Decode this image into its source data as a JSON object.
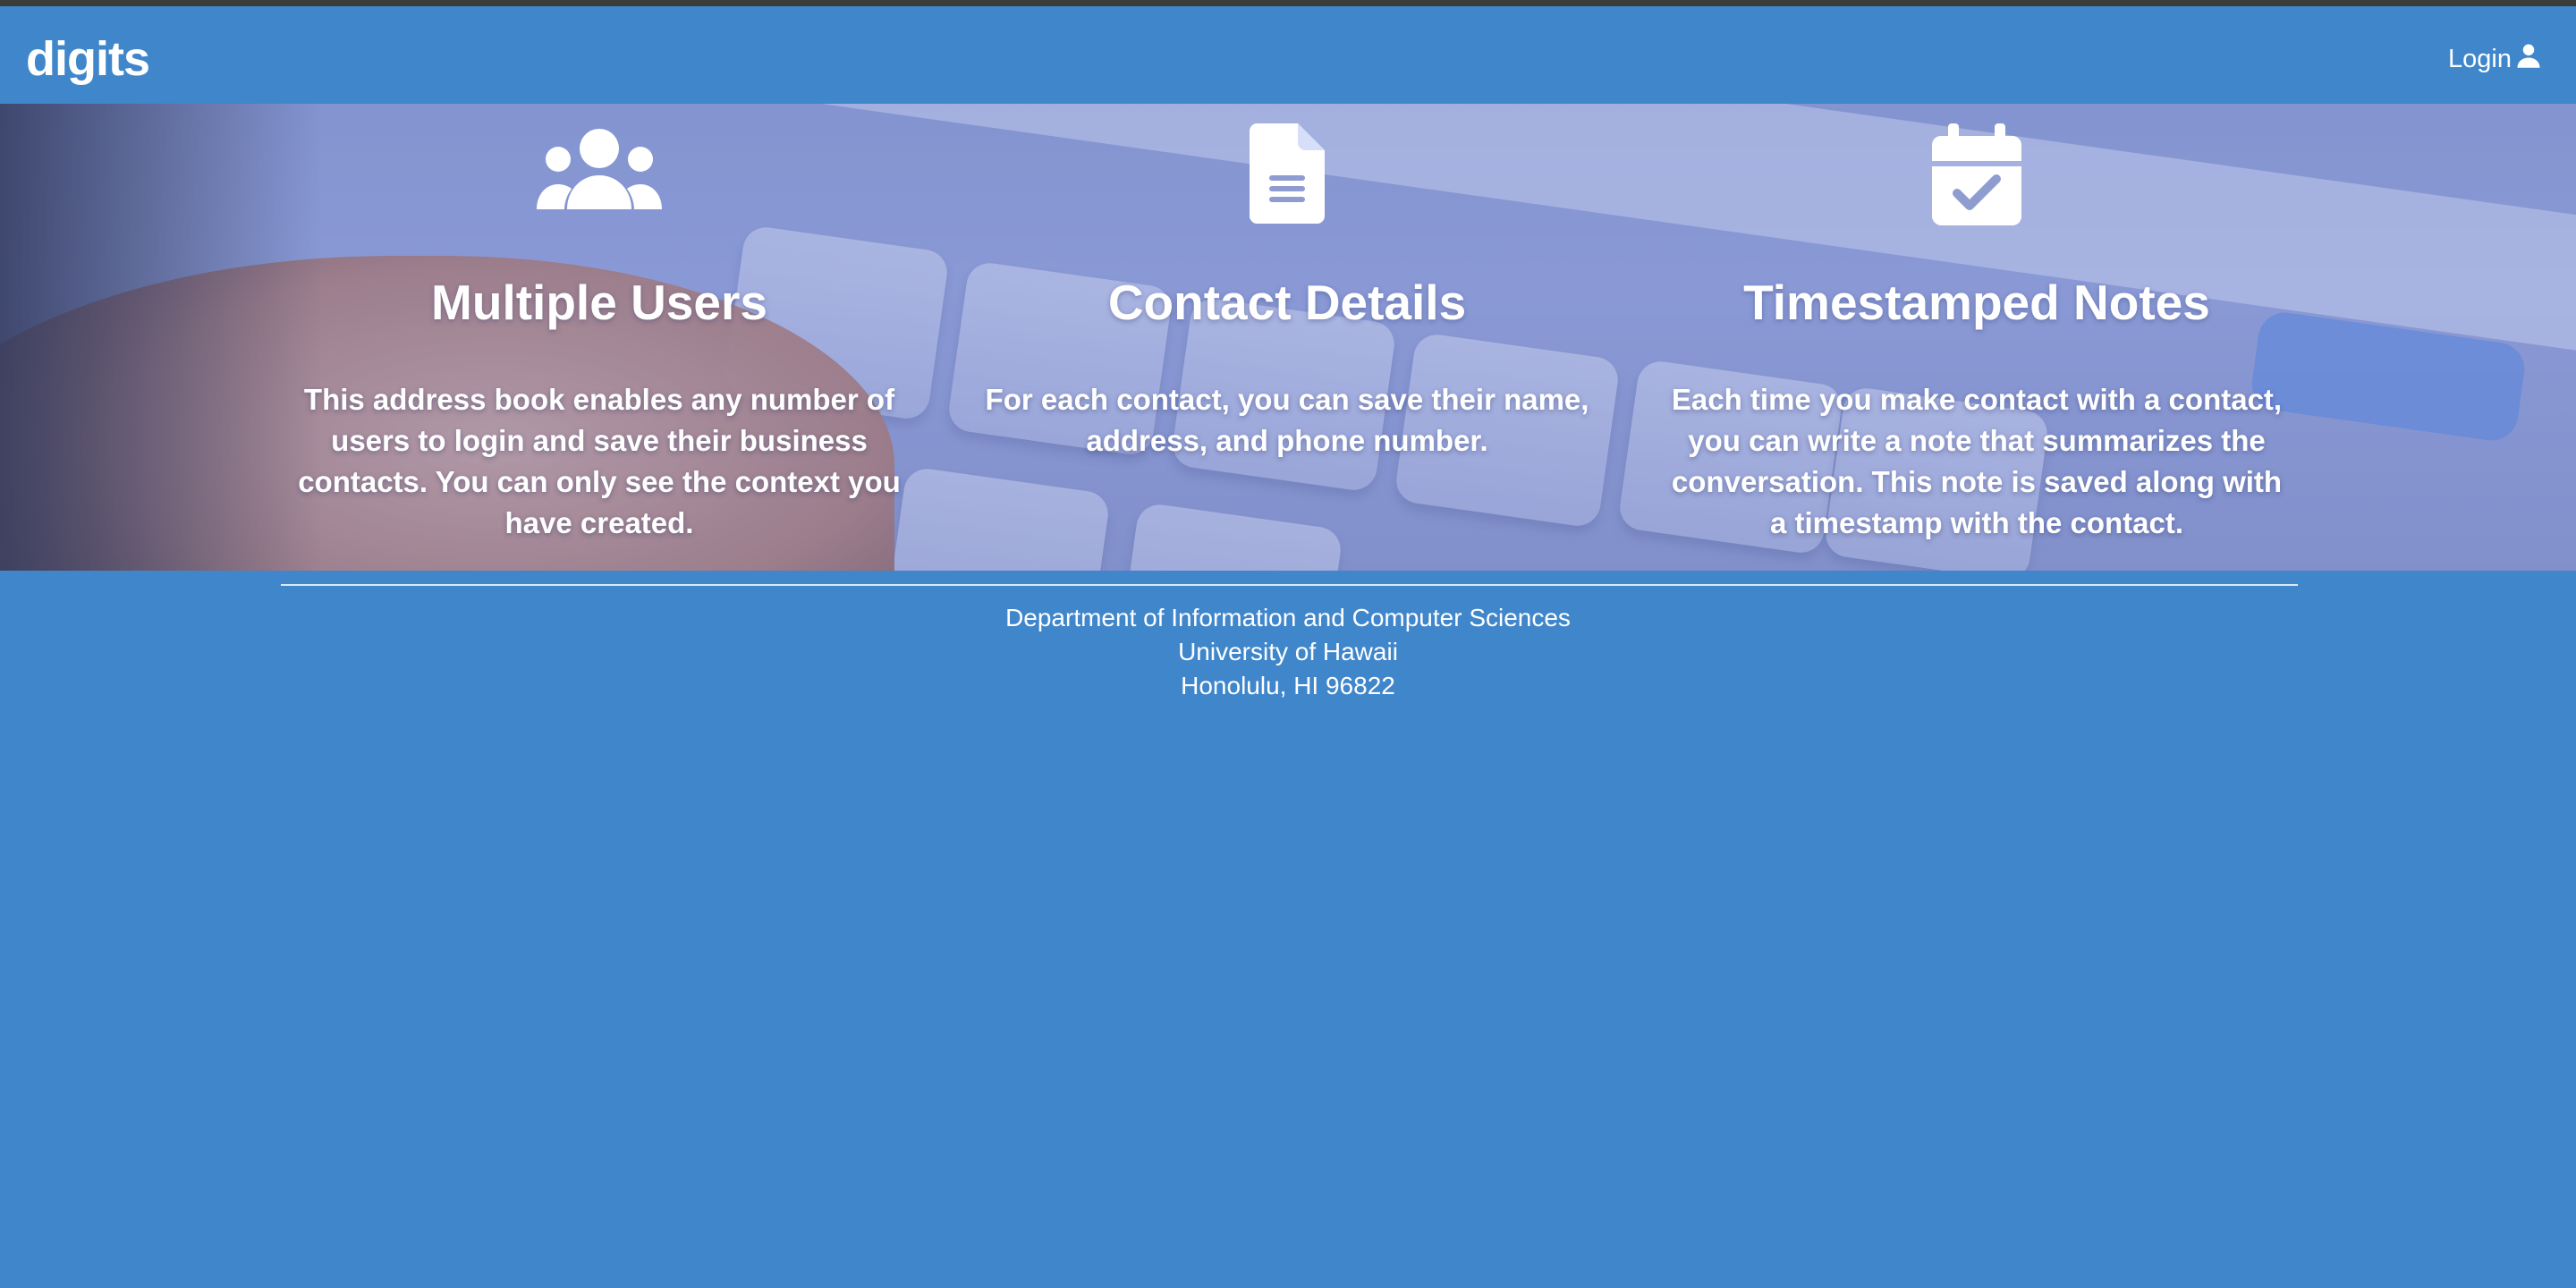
{
  "navbar": {
    "brand": "digits",
    "login_label": "Login",
    "login_icon": "user-icon"
  },
  "features": [
    {
      "icon": "users-icon",
      "title": "Multiple Users",
      "description": "This address book enables any number of users to login and save their business contacts. You can only see the context you have created."
    },
    {
      "icon": "file-lines-icon",
      "title": "Contact Details",
      "description": "For each contact, you can save their name, address, and phone number."
    },
    {
      "icon": "calendar-check-icon",
      "title": "Timestamped Notes",
      "description": "Each time you make contact with a contact, you can write a note that summarizes the conversation. This note is saved along with a timestamp with the contact."
    }
  ],
  "footer": {
    "line1": "Department of Information and Computer Sciences",
    "line2": "University of Hawaii",
    "line3": "Honolulu, HI 96822"
  },
  "colors": {
    "primary": "#3f86cb",
    "text": "#ffffff"
  }
}
